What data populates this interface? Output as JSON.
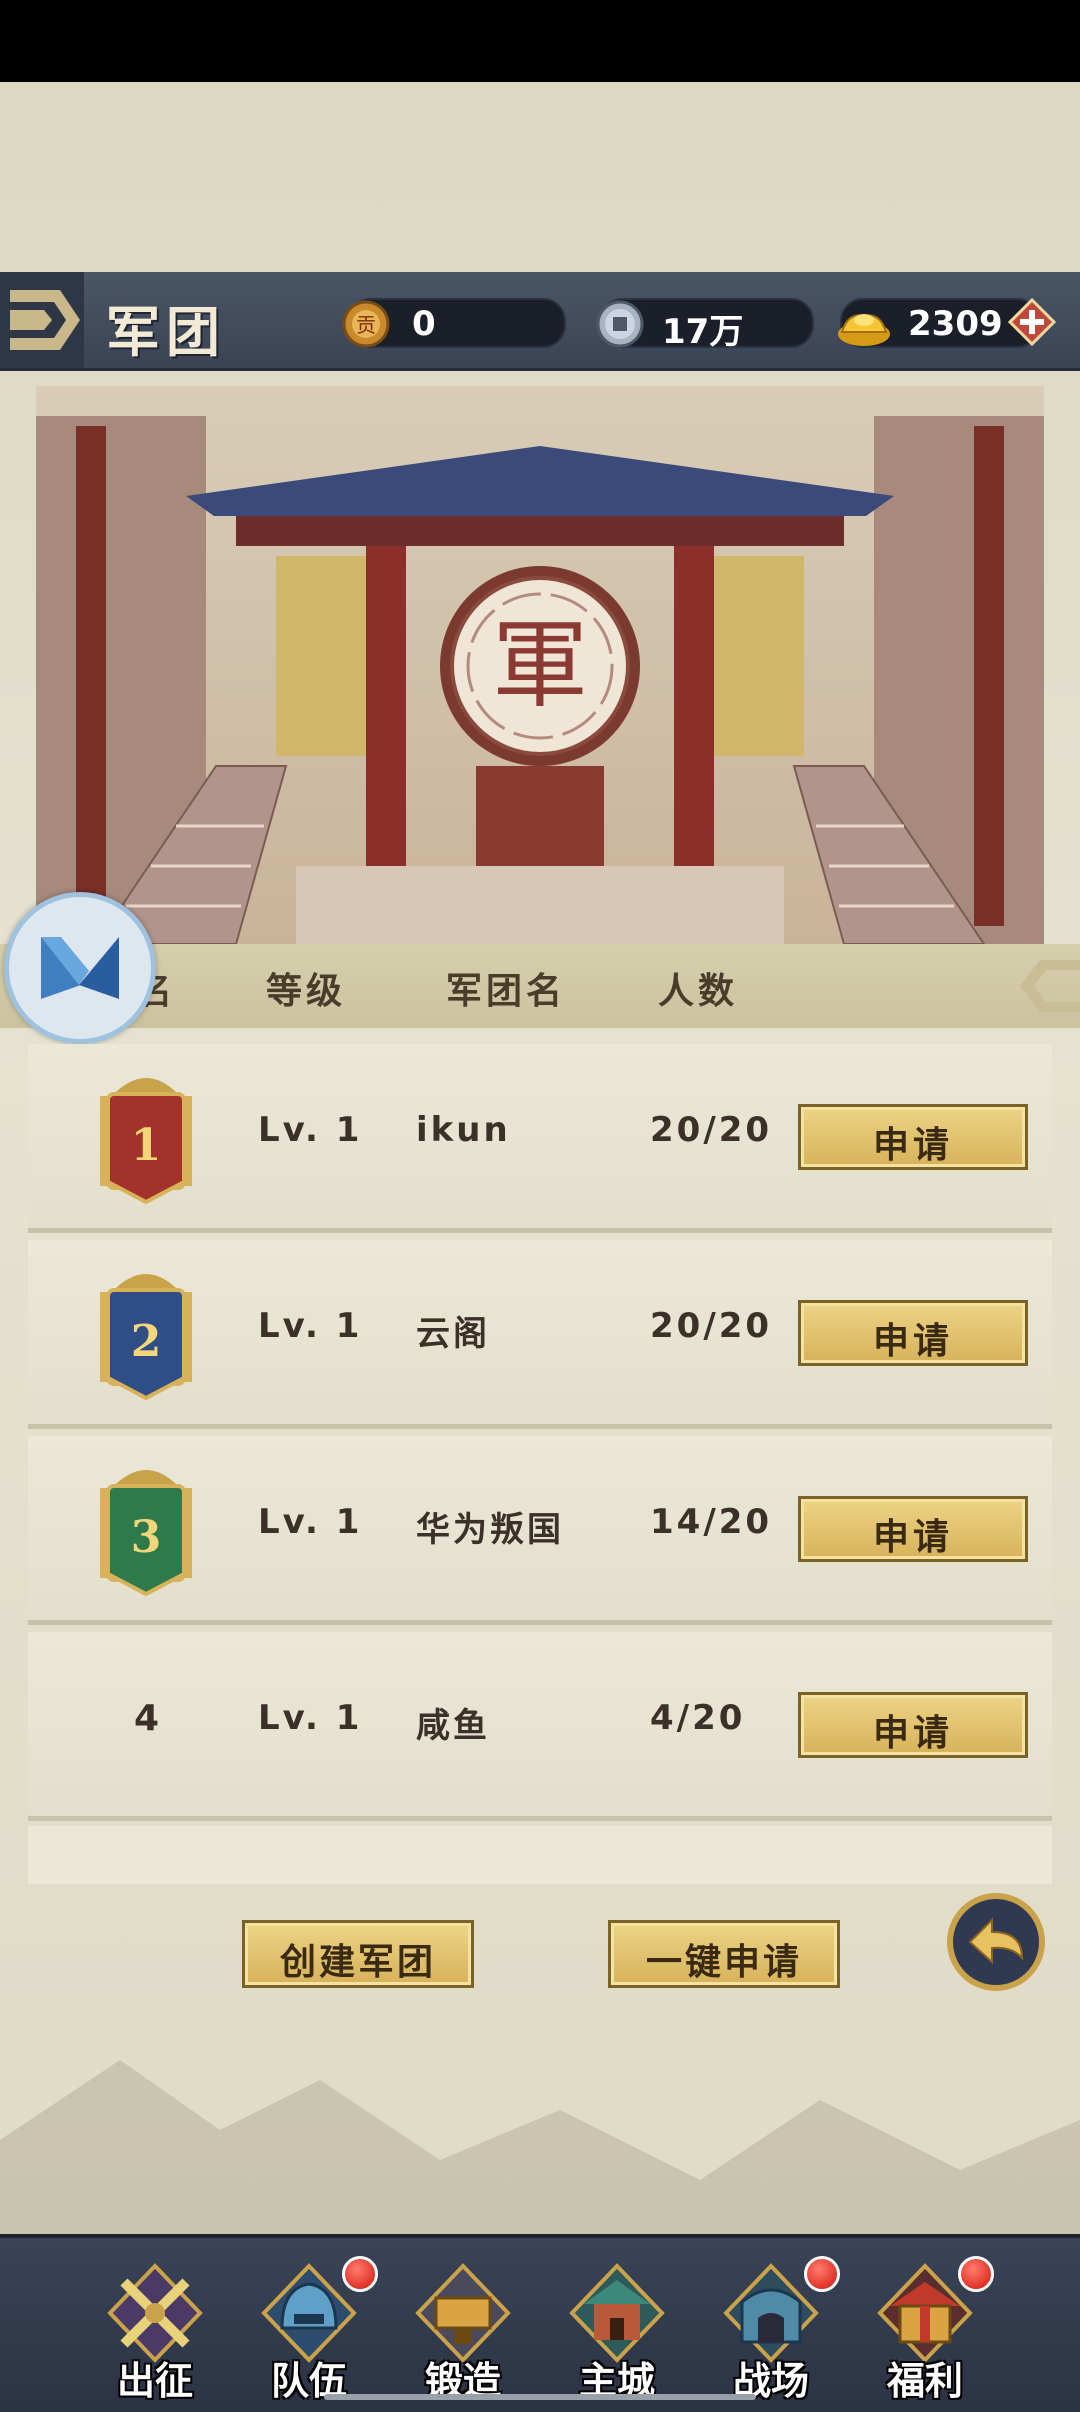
{
  "header": {
    "title": "军团",
    "currencies": [
      {
        "name": "contribution-coin",
        "icon": "coin-icon",
        "value": "0"
      },
      {
        "name": "copper-coins",
        "icon": "copper-coin-icon",
        "value": "17万"
      },
      {
        "name": "gold-ingots",
        "icon": "gold-ingot-icon",
        "value": "2309"
      }
    ]
  },
  "banner": {
    "emblem_text": "軍"
  },
  "table": {
    "columns": [
      "排名",
      "等级",
      "军团名",
      "人数"
    ],
    "rows": [
      {
        "rank": "1",
        "badge_color": "#a3322a",
        "level": "Lv. 1",
        "name": "ikun",
        "members": "20/20",
        "action": "申请"
      },
      {
        "rank": "2",
        "badge_color": "#2f4e86",
        "level": "Lv. 1",
        "name": "云阁",
        "members": "20/20",
        "action": "申请"
      },
      {
        "rank": "3",
        "badge_color": "#2f7a4a",
        "level": "Lv. 1",
        "name": "华为叛国",
        "members": "14/20",
        "action": "申请"
      },
      {
        "rank": "4",
        "badge_color": "",
        "level": "Lv. 1",
        "name": "咸鱼",
        "members": "4/20",
        "action": "申请"
      }
    ]
  },
  "actions": {
    "create": "创建军团",
    "apply_all": "一键申请"
  },
  "nav": [
    {
      "label": "出征",
      "icon": "crossed-swords-icon",
      "badge": false
    },
    {
      "label": "队伍",
      "icon": "helmet-icon",
      "badge": true
    },
    {
      "label": "锻造",
      "icon": "anvil-icon",
      "badge": false
    },
    {
      "label": "主城",
      "icon": "castle-icon",
      "badge": false
    },
    {
      "label": "战场",
      "icon": "battle-gate-icon",
      "badge": true
    },
    {
      "label": "福利",
      "icon": "gift-temple-icon",
      "badge": true
    }
  ],
  "colors": {
    "button_gold": "#d7b25a",
    "header_bg": "#3a4455",
    "notification_red": "#d4140a"
  }
}
